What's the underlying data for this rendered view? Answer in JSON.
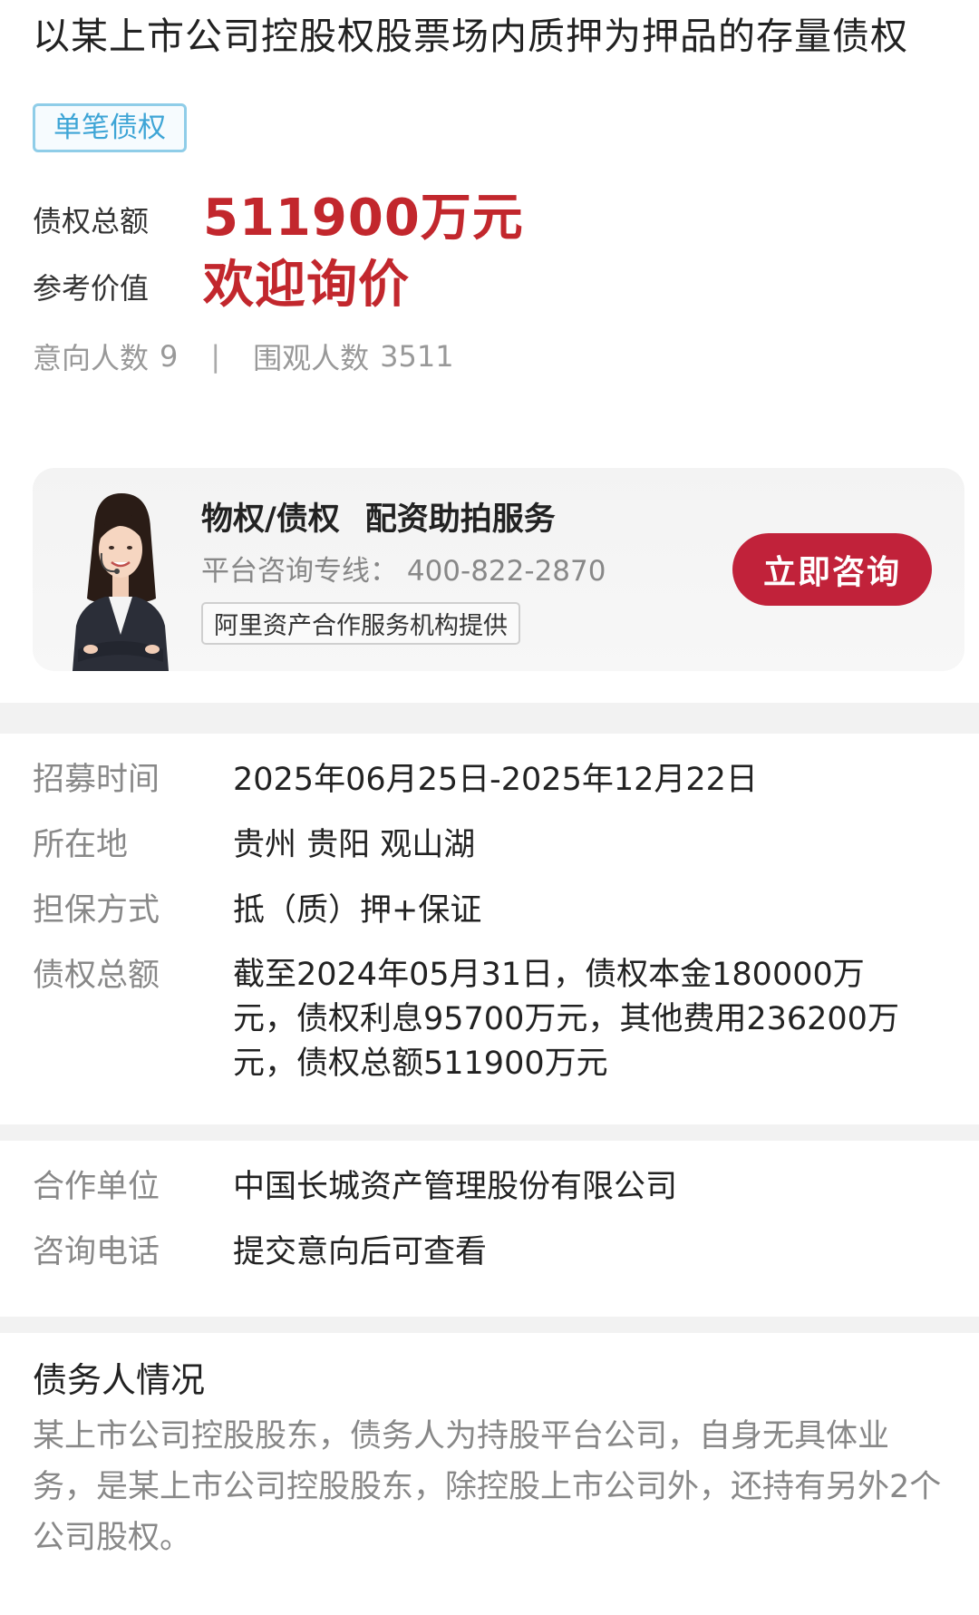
{
  "title": "以某上市公司控股权股票场内质押为押品的存量债权",
  "tag": "单笔债权",
  "summary": {
    "total_label": "债权总额",
    "total_value": "511900万元",
    "ref_label": "参考价值",
    "ref_value": "欢迎询价"
  },
  "stats": {
    "intent_label": "意向人数",
    "intent_count": "9",
    "separator": "|",
    "view_label": "围观人数",
    "view_count": "3511"
  },
  "service_card": {
    "title_a": "物权/债权",
    "title_b": "配资助拍服务",
    "hotline": "平台咨询专线： 400-822-2870",
    "badge": "阿里资产合作服务机构提供",
    "button": "立即咨询"
  },
  "details": [
    {
      "key": "招募时间",
      "value": "2025年06月25日-2025年12月22日"
    },
    {
      "key": "所在地",
      "value": "贵州 贵阳 观山湖"
    },
    {
      "key": "担保方式",
      "value": "抵（质）押+保证"
    },
    {
      "key": "债权总额",
      "value": "截至2024年05月31日，债权本金180000万元，债权利息95700万元，其他费用236200万元，债权总额511900万元"
    }
  ],
  "details2": [
    {
      "key": "合作单位",
      "value": "中国长城资产管理股份有限公司"
    },
    {
      "key": "咨询电话",
      "value": "提交意向后可查看"
    }
  ],
  "debtor": {
    "title": "债务人情况",
    "text": "某上市公司控股股东，债务人为持股平台公司，自身无具体业务，是某上市公司控股股东，除控股上市公司外，还持有另外2个公司股权。"
  },
  "colors": {
    "accent_red": "#c2272d",
    "button_red": "#c1223a",
    "tag_blue": "#3ea5d6"
  }
}
